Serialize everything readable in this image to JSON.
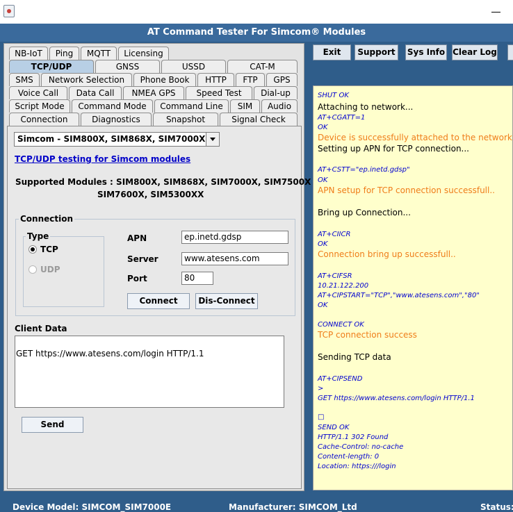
{
  "window": {
    "title": "AT Command Tester For Simcom® Modules"
  },
  "tabs": {
    "row1": [
      "NB-IoT",
      "Ping",
      "MQTT",
      "Licensing"
    ],
    "row2": [
      "TCP/UDP",
      "GNSS",
      "USSD",
      "CAT-M"
    ],
    "row3": [
      "SMS",
      "Network Selection",
      "Phone Book",
      "HTTP",
      "FTP",
      "GPS"
    ],
    "row4": [
      "Voice Call",
      "Data Call",
      "NMEA GPS",
      "Speed Test",
      "Dial-up"
    ],
    "row5": [
      "Script Mode",
      "Command Mode",
      "Command Line",
      "SIM",
      "Audio"
    ],
    "row6": [
      "Connection",
      "Diagnostics",
      "Snapshot",
      "Signal Check"
    ],
    "active": "TCP/UDP"
  },
  "module_select": {
    "value": "Simcom - SIM800X, SIM868X, SIM7000X"
  },
  "link": "TCP/UDP testing for Simcom modules",
  "supported": {
    "label": "Supported Modules :",
    "line1": "SIM800X, SIM868X, SIM7000X, SIM7500X",
    "line2": "SIM7600X, SIM5300XX"
  },
  "connection": {
    "legend": "Connection",
    "type_legend": "Type",
    "tcp_label": "TCP",
    "udp_label": "UDP",
    "apn_label": "APN",
    "apn_value": "ep.inetd.gdsp",
    "server_label": "Server",
    "server_value": "www.atesens.com",
    "port_label": "Port",
    "port_value": "80",
    "connect_button": "Connect",
    "disconnect_button": "Dis-Connect"
  },
  "client_data": {
    "label": "Client Data",
    "value": "GET https://www.atesens.com/login HTTP/1.1",
    "send_button": "Send"
  },
  "toolbar": {
    "exit": "Exit",
    "support": "Support",
    "sys_info": "Sys Info",
    "clear_log": "Clear Log"
  },
  "log": {
    "lines": [
      {
        "text": "SHUT OK",
        "kind": "cmd"
      },
      {
        "text": "Attaching to network...",
        "kind": "info"
      },
      {
        "text": "AT+CGATT=1",
        "kind": "cmd"
      },
      {
        "text": "OK",
        "kind": "cmd"
      },
      {
        "text": "Device is successfully attached to the network",
        "kind": "ok"
      },
      {
        "text": "Setting up APN for TCP connection...",
        "kind": "info"
      },
      {
        "text": "AT+CSTT=\"ep.inetd.gdsp\"",
        "kind": "cmd"
      },
      {
        "text": "OK",
        "kind": "cmd"
      },
      {
        "text": "APN setup for TCP connection successfull..",
        "kind": "ok"
      },
      {
        "text": "Bring up Connection...",
        "kind": "info"
      },
      {
        "text": "AT+CIICR",
        "kind": "cmd"
      },
      {
        "text": "OK",
        "kind": "cmd"
      },
      {
        "text": "Connection bring up successfull..",
        "kind": "ok"
      },
      {
        "text": "AT+CIFSR",
        "kind": "cmd"
      },
      {
        "text": "10.21.122.200",
        "kind": "cmd"
      },
      {
        "text": "AT+CIPSTART=\"TCP\",\"www.atesens.com\",\"80\"",
        "kind": "cmd"
      },
      {
        "text": "OK",
        "kind": "cmd"
      },
      {
        "text": "CONNECT OK",
        "kind": "cmd"
      },
      {
        "text": "TCP connection success",
        "kind": "ok"
      },
      {
        "text": "Sending TCP data",
        "kind": "info"
      },
      {
        "text": "AT+CIPSEND",
        "kind": "cmd"
      },
      {
        "text": ">",
        "kind": "cmd"
      },
      {
        "text": "GET https://www.atesens.com/login HTTP/1.1",
        "kind": "cmd"
      },
      {
        "text": "□",
        "kind": "cmd"
      },
      {
        "text": "SEND OK",
        "kind": "cmd"
      },
      {
        "text": "HTTP/1.1 302 Found",
        "kind": "cmd"
      },
      {
        "text": "Cache-Control: no-cache",
        "kind": "cmd"
      },
      {
        "text": "Content-length: 0",
        "kind": "cmd"
      },
      {
        "text": "Location: https:///login",
        "kind": "cmd"
      }
    ]
  },
  "status": {
    "device_model": "Device Model:  SIMCOM_SIM7000E",
    "manufacturer": "Manufacturer:     SIMCOM_Ltd",
    "status": "Status:"
  },
  "colors": {
    "header_blue": "#3a6a9c",
    "log_bg": "#ffffcc",
    "log_cmd": "#0000d0",
    "log_ok": "#ef7d1a"
  }
}
